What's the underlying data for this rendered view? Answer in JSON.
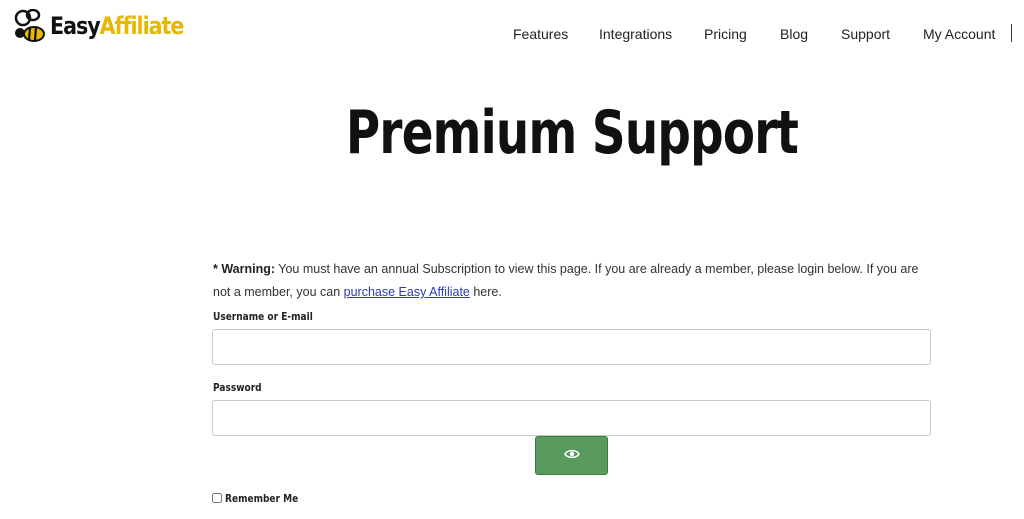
{
  "brand": {
    "name_part1": "Easy",
    "name_part2": "Affiliate",
    "accent_color": "#e6b800",
    "icon": "bee-icon"
  },
  "nav": {
    "items": [
      {
        "label": "Features"
      },
      {
        "label": "Integrations"
      },
      {
        "label": "Pricing"
      },
      {
        "label": "Blog"
      },
      {
        "label": "Support"
      },
      {
        "label": "My Account"
      }
    ]
  },
  "page": {
    "title": "Premium Support"
  },
  "warning": {
    "prefix": "* Warning:",
    "text": " You must have an annual Subscription to view this page. If you are already a member, please login below. If you are not a member, you can ",
    "link_text": "purchase Easy Affiliate",
    "suffix": " here."
  },
  "login_form": {
    "username_label": "Username or E-mail",
    "username_value": "",
    "password_label": "Password",
    "password_value": "",
    "show_password_icon": "eye-icon",
    "button_color": "#5a9a5e",
    "remember_label": "Remember Me",
    "remember_checked": false
  }
}
